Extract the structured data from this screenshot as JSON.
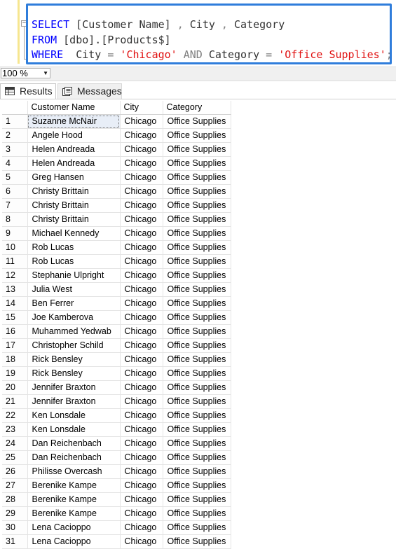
{
  "editor": {
    "line1": {
      "kw_select": "SELECT",
      "rest": " [Customer Name]",
      "comma1": " ,",
      "city": " City",
      "comma2": " ,",
      "category": " Category"
    },
    "line2": {
      "kw_from": "FROM",
      "table": " [dbo].[Products$]"
    },
    "line3": {
      "kw_where": "WHERE",
      "col_city": "  City",
      "eq1": " =",
      "val_city": " 'Chicago'",
      "kw_and": " AND",
      "col_category": " Category",
      "eq2": " =",
      "val_category": " 'Office Supplies'",
      "semicolon": ";"
    },
    "collapse_symbol": "−",
    "highlight_color": "#2f7ddb"
  },
  "zoom": {
    "value": "100 %"
  },
  "tabs": [
    {
      "label": "Results",
      "icon": "grid-icon",
      "active": true
    },
    {
      "label": "Messages",
      "icon": "messages-icon",
      "active": false
    }
  ],
  "grid": {
    "columns": [
      "Customer Name",
      "City",
      "Category"
    ],
    "rows": [
      [
        "1",
        "Suzanne McNair",
        "Chicago",
        "Office Supplies"
      ],
      [
        "2",
        "Angele Hood",
        "Chicago",
        "Office Supplies"
      ],
      [
        "3",
        "Helen Andreada",
        "Chicago",
        "Office Supplies"
      ],
      [
        "4",
        "Helen Andreada",
        "Chicago",
        "Office Supplies"
      ],
      [
        "5",
        "Greg Hansen",
        "Chicago",
        "Office Supplies"
      ],
      [
        "6",
        "Christy Brittain",
        "Chicago",
        "Office Supplies"
      ],
      [
        "7",
        "Christy Brittain",
        "Chicago",
        "Office Supplies"
      ],
      [
        "8",
        "Christy Brittain",
        "Chicago",
        "Office Supplies"
      ],
      [
        "9",
        "Michael Kennedy",
        "Chicago",
        "Office Supplies"
      ],
      [
        "10",
        "Rob Lucas",
        "Chicago",
        "Office Supplies"
      ],
      [
        "11",
        "Rob Lucas",
        "Chicago",
        "Office Supplies"
      ],
      [
        "12",
        "Stephanie Ulpright",
        "Chicago",
        "Office Supplies"
      ],
      [
        "13",
        "Julia West",
        "Chicago",
        "Office Supplies"
      ],
      [
        "14",
        "Ben Ferrer",
        "Chicago",
        "Office Supplies"
      ],
      [
        "15",
        "Joe Kamberova",
        "Chicago",
        "Office Supplies"
      ],
      [
        "16",
        "Muhammed Yedwab",
        "Chicago",
        "Office Supplies"
      ],
      [
        "17",
        "Christopher Schild",
        "Chicago",
        "Office Supplies"
      ],
      [
        "18",
        "Rick Bensley",
        "Chicago",
        "Office Supplies"
      ],
      [
        "19",
        "Rick Bensley",
        "Chicago",
        "Office Supplies"
      ],
      [
        "20",
        "Jennifer Braxton",
        "Chicago",
        "Office Supplies"
      ],
      [
        "21",
        "Jennifer Braxton",
        "Chicago",
        "Office Supplies"
      ],
      [
        "22",
        "Ken Lonsdale",
        "Chicago",
        "Office Supplies"
      ],
      [
        "23",
        "Ken Lonsdale",
        "Chicago",
        "Office Supplies"
      ],
      [
        "24",
        "Dan Reichenbach",
        "Chicago",
        "Office Supplies"
      ],
      [
        "25",
        "Dan Reichenbach",
        "Chicago",
        "Office Supplies"
      ],
      [
        "26",
        "Philisse Overcash",
        "Chicago",
        "Office Supplies"
      ],
      [
        "27",
        "Berenike Kampe",
        "Chicago",
        "Office Supplies"
      ],
      [
        "28",
        "Berenike Kampe",
        "Chicago",
        "Office Supplies"
      ],
      [
        "29",
        "Berenike Kampe",
        "Chicago",
        "Office Supplies"
      ],
      [
        "30",
        "Lena Cacioppo",
        "Chicago",
        "Office Supplies"
      ],
      [
        "31",
        "Lena Cacioppo",
        "Chicago",
        "Office Supplies"
      ]
    ]
  }
}
